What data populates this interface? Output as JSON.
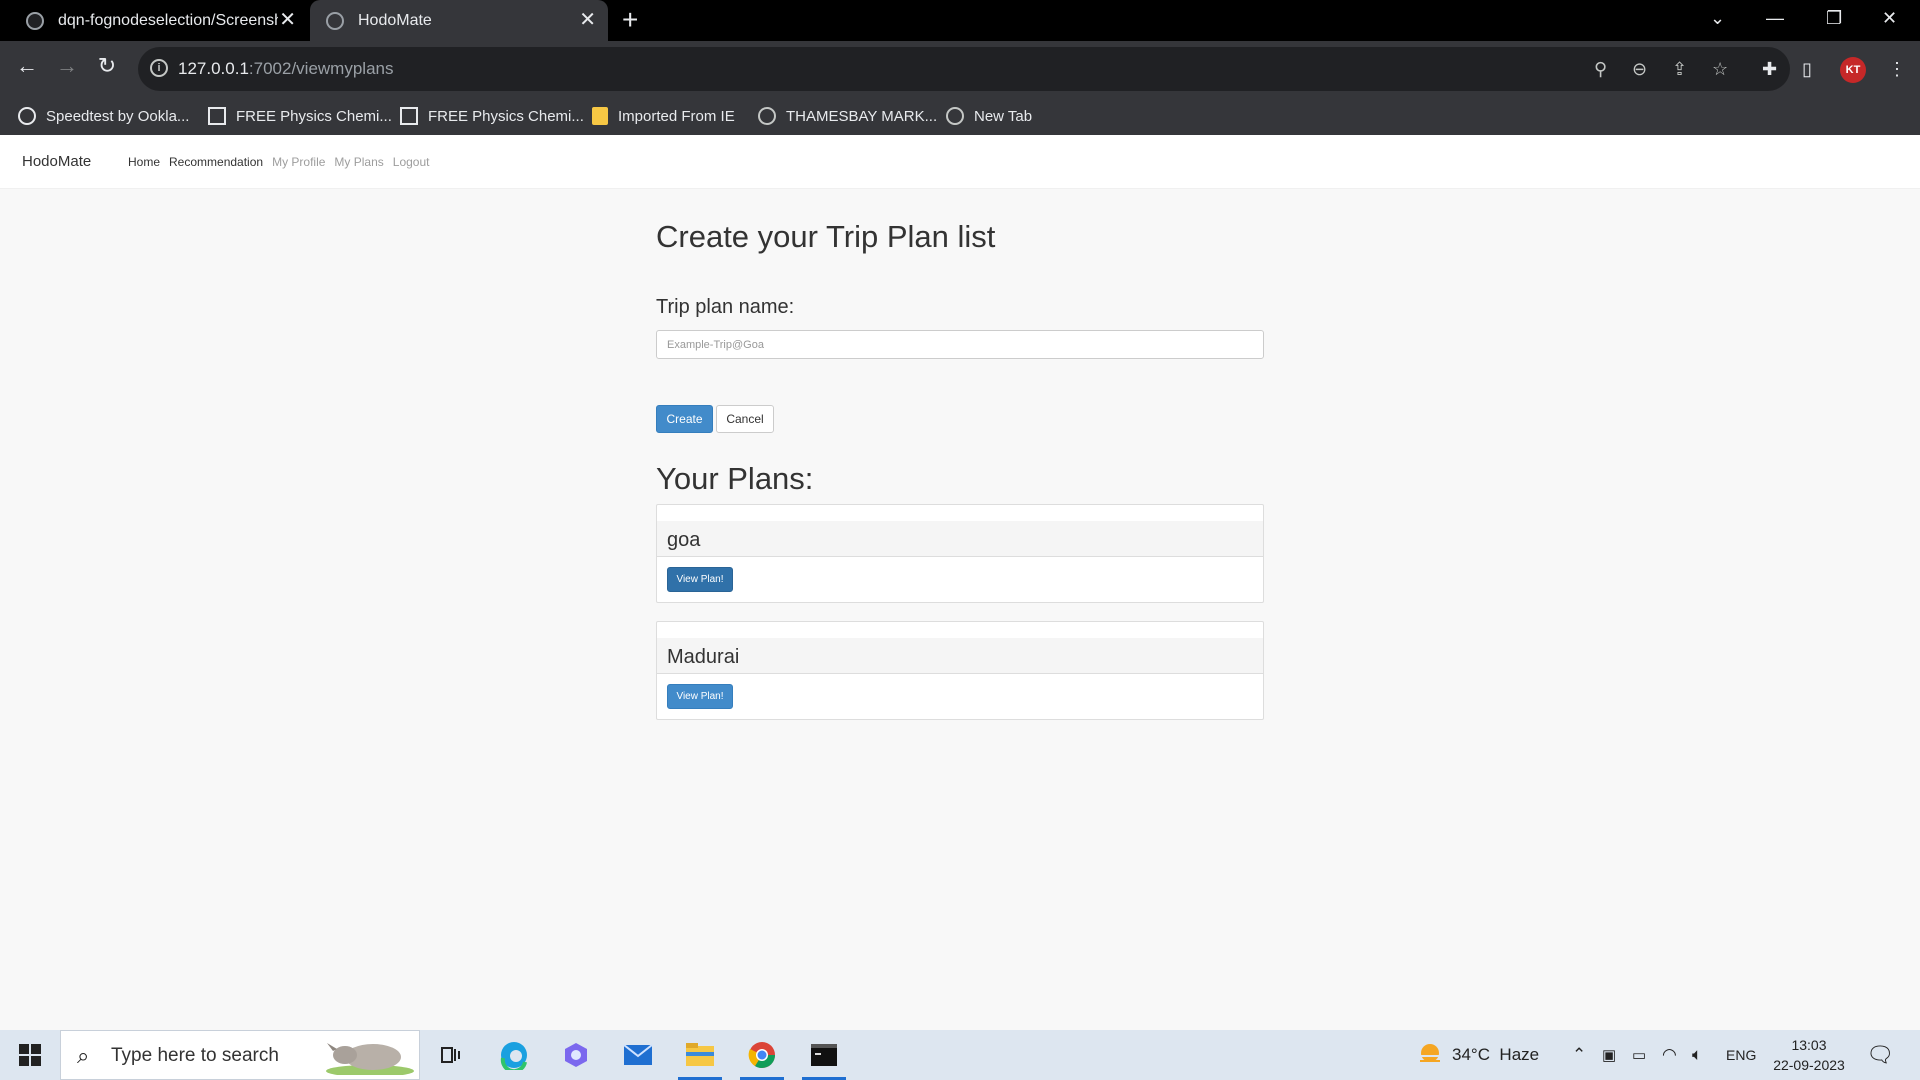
{
  "browser": {
    "tabs": [
      {
        "title": "dqn-fognodeselection/Screensho",
        "active": false
      },
      {
        "title": "HodoMate",
        "active": true
      }
    ],
    "url_host": "127.0.0.1",
    "url_path": ":7002/viewmyplans",
    "bookmarks": [
      {
        "label": "Speedtest by Ookla...",
        "icon": "speedtest-icon"
      },
      {
        "label": "FREE Physics Chemi...",
        "icon": "site-logo-icon"
      },
      {
        "label": "FREE Physics Chemi...",
        "icon": "site-logo-icon"
      },
      {
        "label": "Imported From IE",
        "icon": "folder-icon"
      },
      {
        "label": "THAMESBAY MARK...",
        "icon": "globe-icon"
      },
      {
        "label": "New Tab",
        "icon": "globe-icon"
      }
    ],
    "profile_initials": "KT"
  },
  "app": {
    "brand": "HodoMate",
    "nav": [
      "Home",
      "Recommendation",
      "My Profile",
      "My Plans",
      "Logout"
    ],
    "heading": "Create your Trip Plan list",
    "form": {
      "label": "Trip plan name:",
      "placeholder": "Example-Trip@Goa",
      "value": "",
      "create_label": "Create",
      "cancel_label": "Cancel"
    },
    "plans_heading": "Your Plans:",
    "plans": [
      {
        "name": "goa",
        "button": "View Plan!"
      },
      {
        "name": "Madurai",
        "button": "View Plan!"
      }
    ],
    "colors": {
      "primary": "#428bca",
      "primary_dark": "#3071a9",
      "navbar_bg": "#ffffff",
      "page_bg": "#f8f8f8"
    }
  },
  "taskbar": {
    "search_placeholder": "Type here to search",
    "weather": "34°C  Haze",
    "language": "ENG",
    "time": "13:03",
    "date": "22-09-2023"
  }
}
